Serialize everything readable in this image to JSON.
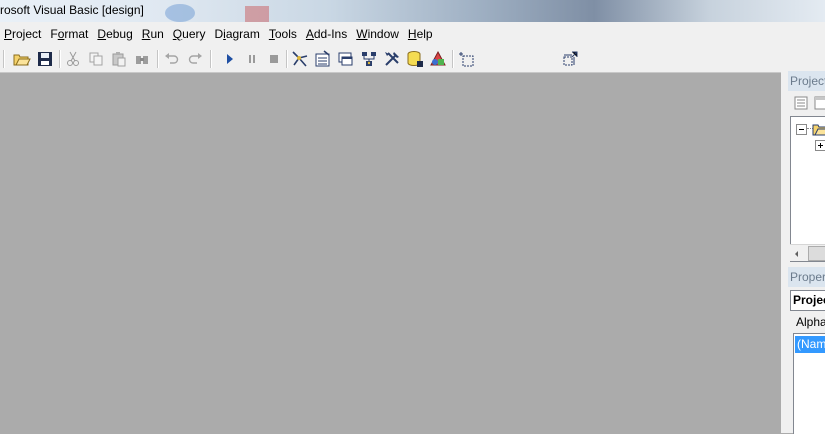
{
  "window": {
    "title": "rosoft Visual Basic [design]"
  },
  "menu": [
    {
      "label": "Project",
      "accel_index": 0
    },
    {
      "label": "Format",
      "accel_index": 1
    },
    {
      "label": "Debug",
      "accel_index": 0
    },
    {
      "label": "Run",
      "accel_index": 0
    },
    {
      "label": "Query",
      "accel_index": 0
    },
    {
      "label": "Diagram",
      "accel_index": 1
    },
    {
      "label": "Tools",
      "accel_index": 0
    },
    {
      "label": "Add-Ins",
      "accel_index": 0
    },
    {
      "label": "Window",
      "accel_index": 0
    },
    {
      "label": "Help",
      "accel_index": 0
    }
  ],
  "toolbar": {
    "buttons": [
      "open-project-icon",
      "save-project-icon",
      "cut-icon",
      "copy-icon",
      "paste-icon",
      "find-icon",
      "undo-icon",
      "redo-icon",
      "start-icon",
      "break-icon",
      "end-icon",
      "project-explorer-icon",
      "properties-window-icon",
      "form-layout-icon",
      "object-browser-icon",
      "toolbox-icon",
      "data-view-icon",
      "visual-component-manager-icon",
      "add-form-icon",
      "size-position-icon"
    ]
  },
  "project_panel": {
    "title": "Project"
  },
  "properties_panel": {
    "title": "Proper",
    "object_combo": "Projec",
    "tab_alpha": "Alphal",
    "selected_property": "(Name"
  },
  "colors": {
    "workspace": "#ababab",
    "selection": "#3399ff",
    "panel_title_bg": "#dbe5ef"
  }
}
